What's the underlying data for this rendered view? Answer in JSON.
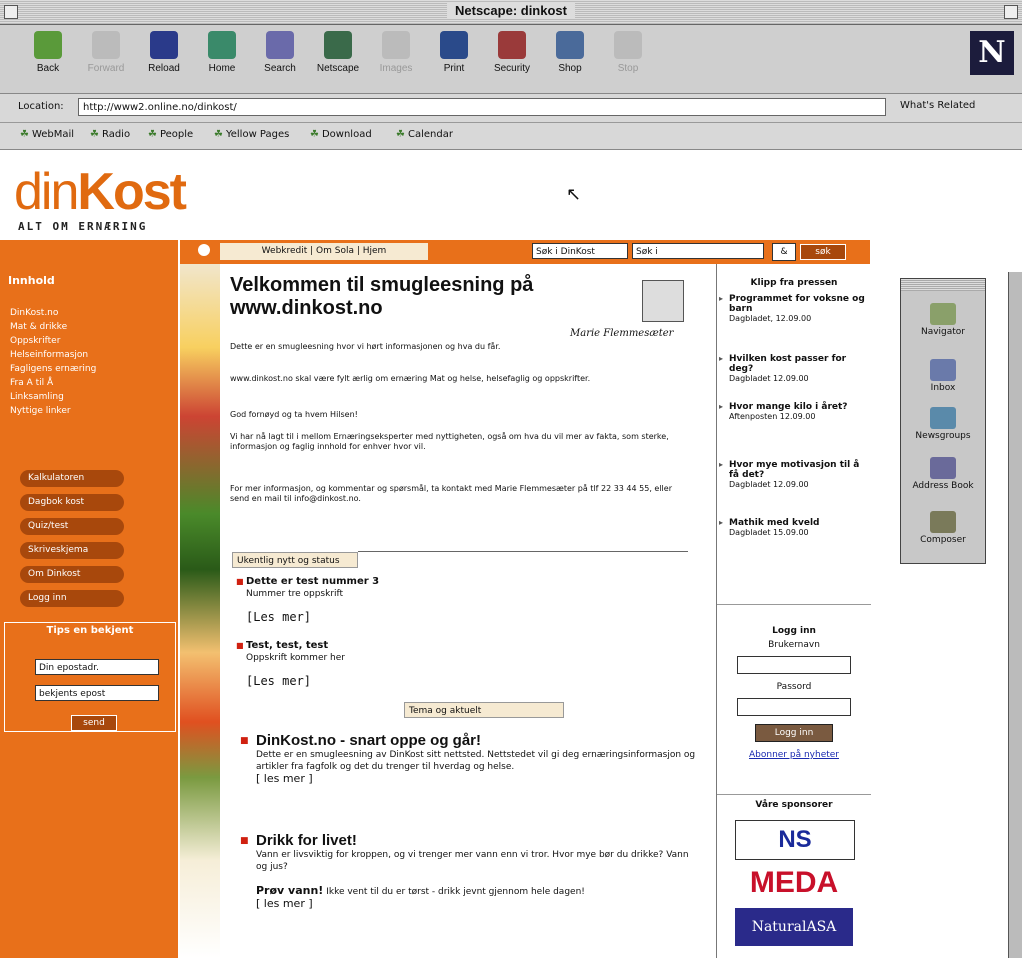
{
  "window": {
    "title": "Netscape: dinkost"
  },
  "toolbar": {
    "buttons": [
      {
        "label": "Back",
        "icon": "back-icon",
        "enabled": true
      },
      {
        "label": "Forward",
        "icon": "forward-icon",
        "enabled": false
      },
      {
        "label": "Reload",
        "icon": "reload-icon",
        "enabled": true
      },
      {
        "label": "Home",
        "icon": "home-icon",
        "enabled": true
      },
      {
        "label": "Search",
        "icon": "search-icon",
        "enabled": true
      },
      {
        "label": "Netscape",
        "icon": "netscape-icon",
        "enabled": true
      },
      {
        "label": "Images",
        "icon": "images-icon",
        "enabled": false
      },
      {
        "label": "Print",
        "icon": "print-icon",
        "enabled": true
      },
      {
        "label": "Security",
        "icon": "security-icon",
        "enabled": true
      },
      {
        "label": "Shop",
        "icon": "shop-icon",
        "enabled": true
      },
      {
        "label": "Stop",
        "icon": "stop-icon",
        "enabled": false
      }
    ],
    "brand": "N"
  },
  "location": {
    "label": "Location:",
    "url": "http://www2.online.no/dinkost/",
    "related": "What's Related"
  },
  "personal": [
    "WebMail",
    "Radio",
    "People",
    "Yellow Pages",
    "Download",
    "Calendar"
  ],
  "page": {
    "logo_din": "din",
    "logo_kost": "Kost",
    "tagline": "ALT OM ERNÆRING",
    "nav_head": "Innhold",
    "nav_links": [
      "DinKost.no",
      "Mat & drikke",
      "Oppskrifter",
      "Helseinformasjon",
      "Fagligens ernæring",
      "Fra A til Å",
      "Linksamling",
      "Nyttige linker"
    ],
    "pills": [
      "Kalkulatoren",
      "Dagbok kost",
      "Quiz/test",
      "Skriveskjema",
      "Om Dinkost",
      "Logg inn"
    ],
    "tips": {
      "title": "Tips en bekjent",
      "field1": "Din epostadr.",
      "field2": "bekjents epost",
      "button": "send"
    },
    "crumb": "Webkredit | Om Sola | Hjem",
    "search_select1": "Søk i DinKost",
    "search_select2": "Søk i",
    "search_go": "&",
    "search_btn": "søk",
    "main": {
      "title": "Velkommen til smugleesning på www.dinkost.no",
      "signature": "Marie Flemmesæter",
      "paragraphs": [
        "Dette er en smugleesning hvor vi hørt informasjonen og hva du får.",
        "www.dinkost.no skal være fylt ærlig om ernæring Mat og helse, helsefaglig og oppskrifter.",
        "God fornøyd og ta hvem Hilsen!",
        "Vi har nå lagt til i mellom Ernæringseksperter med nyttigheten, også om hva du vil mer av fakta, som sterke, informasjon og faglig innhold for enhver hvor vil.",
        "For mer informasjon, og kommentar og spørsmål, ta kontakt med Marie Flemmesæter på tlf 22 33 44 55, eller send en mail til info@dinkost.no."
      ],
      "section1": "Ukentlig nytt og status",
      "news1": {
        "title": "Dette er test nummer 3",
        "text": "Nummer tre oppskrift",
        "more": "[Les mer]"
      },
      "news2": {
        "title": "Test, test, test",
        "text": "Oppskrift kommer her",
        "more": "[Les mer]"
      },
      "section2": "Tema og aktuelt",
      "feat1": {
        "title": "DinKost.no - snart oppe og går!",
        "text": "Dette er en smugleesning av DinKost sitt nettsted. Nettstedet vil gi deg ernæringsinformasjon og artikler fra fagfolk og det du trenger til hverdag og helse.",
        "more": "[ les mer ]"
      },
      "feat2": {
        "title": "Drikk for livet!",
        "text": "Vann er livsviktig for kroppen, og vi trenger mer vann enn vi tror. Hvor mye bør du drikke? Vann og jus?",
        "extra_bold": "Prøv vann!",
        "extra": "Ikke vent til du er tørst - drikk jevnt gjennom hele dagen!",
        "more": "[ les mer ]"
      }
    },
    "right": {
      "tips_head": "Klipp fra pressen",
      "items": [
        {
          "title": "Programmet for voksne og barn",
          "meta": "Dagbladet, 12.09.00"
        },
        {
          "title": "Hvilken kost passer for deg?",
          "meta": "Dagbladet 12.09.00"
        },
        {
          "title": "Hvor mange kilo i året?",
          "meta": "Aftenposten 12.09.00"
        },
        {
          "title": "Hvor mye motivasjon til å få det?",
          "meta": "Dagbladet 12.09.00"
        },
        {
          "title": "Mathik med kveld",
          "meta": "Dagbladet 15.09.00"
        }
      ],
      "login": {
        "head": "Logg inn",
        "user": "Brukernavn",
        "pass": "Passord",
        "btn": "Logg inn",
        "link": "Abonner på nyheter"
      },
      "sponsor_head": "Våre sponsorer",
      "sponsors": [
        "NS",
        "MEDA",
        "NaturalASA"
      ]
    },
    "palette": [
      "Navigator",
      "Inbox",
      "Newsgroups",
      "Address Book",
      "Composer"
    ]
  },
  "colors": {
    "accent": "#e8701a",
    "dark_accent": "#a8480c",
    "bullet": "#d02010"
  }
}
